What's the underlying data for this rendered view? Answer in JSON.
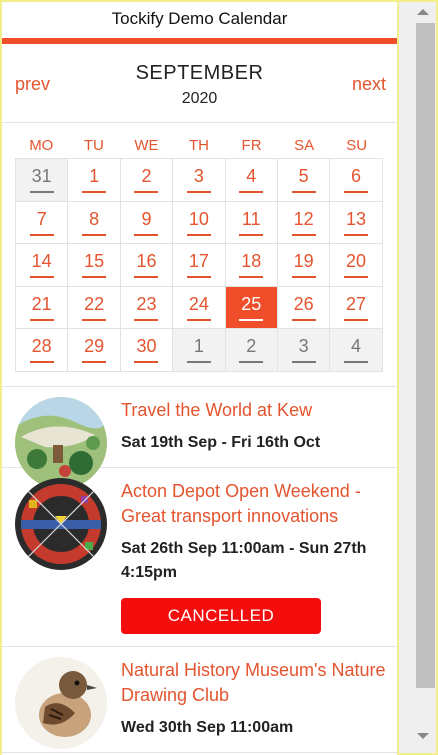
{
  "header": {
    "title": "Tockify Demo Calendar"
  },
  "nav": {
    "prev": "prev",
    "next": "next",
    "month": "SEPTEMBER",
    "year": "2020"
  },
  "weekdays": [
    "MO",
    "TU",
    "WE",
    "TH",
    "FR",
    "SA",
    "SU"
  ],
  "days": [
    {
      "n": "31",
      "type": "other"
    },
    {
      "n": "1",
      "type": "cur"
    },
    {
      "n": "2",
      "type": "cur"
    },
    {
      "n": "3",
      "type": "cur"
    },
    {
      "n": "4",
      "type": "cur"
    },
    {
      "n": "5",
      "type": "cur"
    },
    {
      "n": "6",
      "type": "cur"
    },
    {
      "n": "7",
      "type": "cur"
    },
    {
      "n": "8",
      "type": "cur"
    },
    {
      "n": "9",
      "type": "cur"
    },
    {
      "n": "10",
      "type": "cur"
    },
    {
      "n": "11",
      "type": "cur"
    },
    {
      "n": "12",
      "type": "cur"
    },
    {
      "n": "13",
      "type": "cur"
    },
    {
      "n": "14",
      "type": "cur"
    },
    {
      "n": "15",
      "type": "cur"
    },
    {
      "n": "16",
      "type": "cur"
    },
    {
      "n": "17",
      "type": "cur"
    },
    {
      "n": "18",
      "type": "cur"
    },
    {
      "n": "19",
      "type": "cur"
    },
    {
      "n": "20",
      "type": "cur"
    },
    {
      "n": "21",
      "type": "cur"
    },
    {
      "n": "22",
      "type": "cur"
    },
    {
      "n": "23",
      "type": "cur"
    },
    {
      "n": "24",
      "type": "cur"
    },
    {
      "n": "25",
      "type": "today"
    },
    {
      "n": "26",
      "type": "cur"
    },
    {
      "n": "27",
      "type": "cur"
    },
    {
      "n": "28",
      "type": "cur"
    },
    {
      "n": "29",
      "type": "cur"
    },
    {
      "n": "30",
      "type": "cur"
    },
    {
      "n": "1",
      "type": "other"
    },
    {
      "n": "2",
      "type": "other"
    },
    {
      "n": "3",
      "type": "other"
    },
    {
      "n": "4",
      "type": "other"
    }
  ],
  "events": [
    {
      "title": "Travel the World at Kew",
      "time": "Sat 19th Sep - Fri 16th Oct",
      "image": "kew-garden-illustration"
    },
    {
      "title": "Acton Depot Open Weekend - Great transport innovations",
      "time": "Sat 26th Sep 11:00am - Sun 27th 4:15pm",
      "status": "CANCELLED",
      "image": "transport-roundel-art"
    },
    {
      "title": "Natural History Museum's Nature Drawing Club",
      "time": "Wed 30th Sep 11:00am",
      "image": "sparrow-bird-drawing"
    }
  ],
  "colors": {
    "accent": "#f04e2a",
    "link": "#e4542e",
    "cancelled": "#f40d0d",
    "page_bg": "#f3ee8c"
  }
}
